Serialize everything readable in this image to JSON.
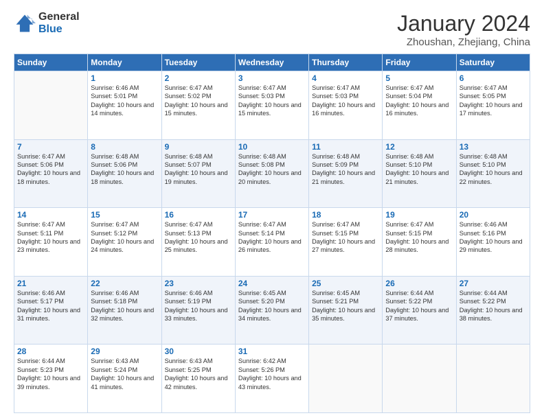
{
  "logo": {
    "general": "General",
    "blue": "Blue"
  },
  "header": {
    "month": "January 2024",
    "location": "Zhoushan, Zhejiang, China"
  },
  "weekdays": [
    "Sunday",
    "Monday",
    "Tuesday",
    "Wednesday",
    "Thursday",
    "Friday",
    "Saturday"
  ],
  "weeks": [
    [
      {
        "day": "",
        "sunrise": "",
        "sunset": "",
        "daylight": ""
      },
      {
        "day": "1",
        "sunrise": "Sunrise: 6:46 AM",
        "sunset": "Sunset: 5:01 PM",
        "daylight": "Daylight: 10 hours and 14 minutes."
      },
      {
        "day": "2",
        "sunrise": "Sunrise: 6:47 AM",
        "sunset": "Sunset: 5:02 PM",
        "daylight": "Daylight: 10 hours and 15 minutes."
      },
      {
        "day": "3",
        "sunrise": "Sunrise: 6:47 AM",
        "sunset": "Sunset: 5:03 PM",
        "daylight": "Daylight: 10 hours and 15 minutes."
      },
      {
        "day": "4",
        "sunrise": "Sunrise: 6:47 AM",
        "sunset": "Sunset: 5:03 PM",
        "daylight": "Daylight: 10 hours and 16 minutes."
      },
      {
        "day": "5",
        "sunrise": "Sunrise: 6:47 AM",
        "sunset": "Sunset: 5:04 PM",
        "daylight": "Daylight: 10 hours and 16 minutes."
      },
      {
        "day": "6",
        "sunrise": "Sunrise: 6:47 AM",
        "sunset": "Sunset: 5:05 PM",
        "daylight": "Daylight: 10 hours and 17 minutes."
      }
    ],
    [
      {
        "day": "7",
        "sunrise": "Sunrise: 6:47 AM",
        "sunset": "Sunset: 5:06 PM",
        "daylight": "Daylight: 10 hours and 18 minutes."
      },
      {
        "day": "8",
        "sunrise": "Sunrise: 6:48 AM",
        "sunset": "Sunset: 5:06 PM",
        "daylight": "Daylight: 10 hours and 18 minutes."
      },
      {
        "day": "9",
        "sunrise": "Sunrise: 6:48 AM",
        "sunset": "Sunset: 5:07 PM",
        "daylight": "Daylight: 10 hours and 19 minutes."
      },
      {
        "day": "10",
        "sunrise": "Sunrise: 6:48 AM",
        "sunset": "Sunset: 5:08 PM",
        "daylight": "Daylight: 10 hours and 20 minutes."
      },
      {
        "day": "11",
        "sunrise": "Sunrise: 6:48 AM",
        "sunset": "Sunset: 5:09 PM",
        "daylight": "Daylight: 10 hours and 21 minutes."
      },
      {
        "day": "12",
        "sunrise": "Sunrise: 6:48 AM",
        "sunset": "Sunset: 5:10 PM",
        "daylight": "Daylight: 10 hours and 21 minutes."
      },
      {
        "day": "13",
        "sunrise": "Sunrise: 6:48 AM",
        "sunset": "Sunset: 5:10 PM",
        "daylight": "Daylight: 10 hours and 22 minutes."
      }
    ],
    [
      {
        "day": "14",
        "sunrise": "Sunrise: 6:47 AM",
        "sunset": "Sunset: 5:11 PM",
        "daylight": "Daylight: 10 hours and 23 minutes."
      },
      {
        "day": "15",
        "sunrise": "Sunrise: 6:47 AM",
        "sunset": "Sunset: 5:12 PM",
        "daylight": "Daylight: 10 hours and 24 minutes."
      },
      {
        "day": "16",
        "sunrise": "Sunrise: 6:47 AM",
        "sunset": "Sunset: 5:13 PM",
        "daylight": "Daylight: 10 hours and 25 minutes."
      },
      {
        "day": "17",
        "sunrise": "Sunrise: 6:47 AM",
        "sunset": "Sunset: 5:14 PM",
        "daylight": "Daylight: 10 hours and 26 minutes."
      },
      {
        "day": "18",
        "sunrise": "Sunrise: 6:47 AM",
        "sunset": "Sunset: 5:15 PM",
        "daylight": "Daylight: 10 hours and 27 minutes."
      },
      {
        "day": "19",
        "sunrise": "Sunrise: 6:47 AM",
        "sunset": "Sunset: 5:15 PM",
        "daylight": "Daylight: 10 hours and 28 minutes."
      },
      {
        "day": "20",
        "sunrise": "Sunrise: 6:46 AM",
        "sunset": "Sunset: 5:16 PM",
        "daylight": "Daylight: 10 hours and 29 minutes."
      }
    ],
    [
      {
        "day": "21",
        "sunrise": "Sunrise: 6:46 AM",
        "sunset": "Sunset: 5:17 PM",
        "daylight": "Daylight: 10 hours and 31 minutes."
      },
      {
        "day": "22",
        "sunrise": "Sunrise: 6:46 AM",
        "sunset": "Sunset: 5:18 PM",
        "daylight": "Daylight: 10 hours and 32 minutes."
      },
      {
        "day": "23",
        "sunrise": "Sunrise: 6:46 AM",
        "sunset": "Sunset: 5:19 PM",
        "daylight": "Daylight: 10 hours and 33 minutes."
      },
      {
        "day": "24",
        "sunrise": "Sunrise: 6:45 AM",
        "sunset": "Sunset: 5:20 PM",
        "daylight": "Daylight: 10 hours and 34 minutes."
      },
      {
        "day": "25",
        "sunrise": "Sunrise: 6:45 AM",
        "sunset": "Sunset: 5:21 PM",
        "daylight": "Daylight: 10 hours and 35 minutes."
      },
      {
        "day": "26",
        "sunrise": "Sunrise: 6:44 AM",
        "sunset": "Sunset: 5:22 PM",
        "daylight": "Daylight: 10 hours and 37 minutes."
      },
      {
        "day": "27",
        "sunrise": "Sunrise: 6:44 AM",
        "sunset": "Sunset: 5:22 PM",
        "daylight": "Daylight: 10 hours and 38 minutes."
      }
    ],
    [
      {
        "day": "28",
        "sunrise": "Sunrise: 6:44 AM",
        "sunset": "Sunset: 5:23 PM",
        "daylight": "Daylight: 10 hours and 39 minutes."
      },
      {
        "day": "29",
        "sunrise": "Sunrise: 6:43 AM",
        "sunset": "Sunset: 5:24 PM",
        "daylight": "Daylight: 10 hours and 41 minutes."
      },
      {
        "day": "30",
        "sunrise": "Sunrise: 6:43 AM",
        "sunset": "Sunset: 5:25 PM",
        "daylight": "Daylight: 10 hours and 42 minutes."
      },
      {
        "day": "31",
        "sunrise": "Sunrise: 6:42 AM",
        "sunset": "Sunset: 5:26 PM",
        "daylight": "Daylight: 10 hours and 43 minutes."
      },
      {
        "day": "",
        "sunrise": "",
        "sunset": "",
        "daylight": ""
      },
      {
        "day": "",
        "sunrise": "",
        "sunset": "",
        "daylight": ""
      },
      {
        "day": "",
        "sunrise": "",
        "sunset": "",
        "daylight": ""
      }
    ]
  ]
}
